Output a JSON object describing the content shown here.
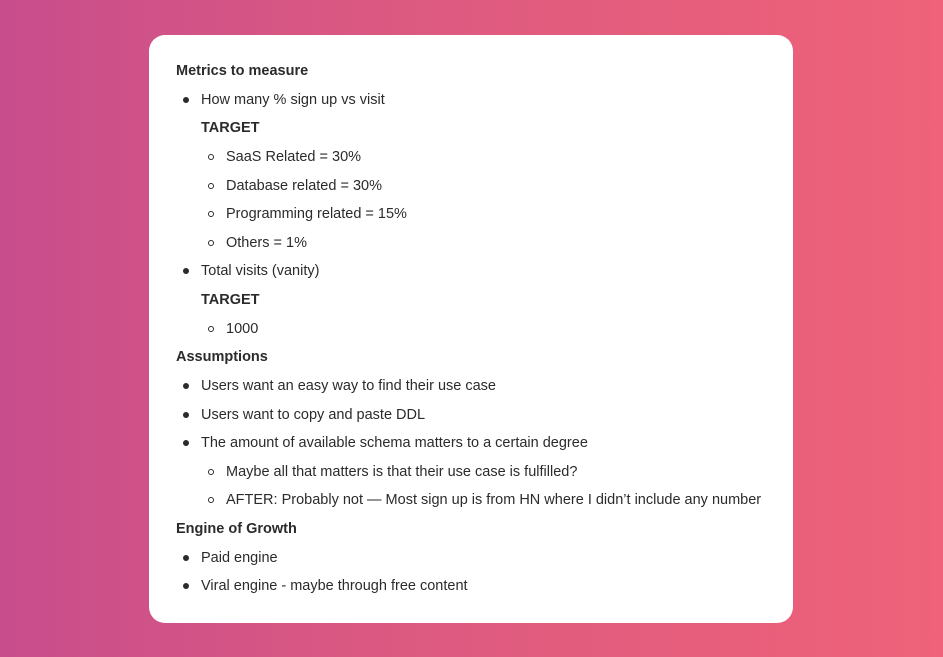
{
  "sections": {
    "metrics": {
      "title": "Metrics to measure",
      "item1": {
        "text": "How many % sign up vs visit",
        "target_label": "TARGET",
        "targets": [
          "SaaS Related = 30%",
          "Database related = 30%",
          "Programming related = 15%",
          "Others = 1%"
        ]
      },
      "item2": {
        "text": "Total visits (vanity)",
        "target_label": "TARGET",
        "targets": [
          "1000"
        ]
      }
    },
    "assumptions": {
      "title": "Assumptions",
      "items": [
        "Users want an easy way to find their use case",
        "Users want to copy and paste DDL",
        "The amount of available schema matters to a certain degree"
      ],
      "subitems": [
        "Maybe all that matters is that their use case is fulfilled?",
        "AFTER: Probably not — Most sign up is from HN where I didn’t include any number"
      ]
    },
    "growth": {
      "title": "Engine of Growth",
      "items": [
        "Paid engine",
        "Viral engine - maybe through free content"
      ]
    }
  }
}
